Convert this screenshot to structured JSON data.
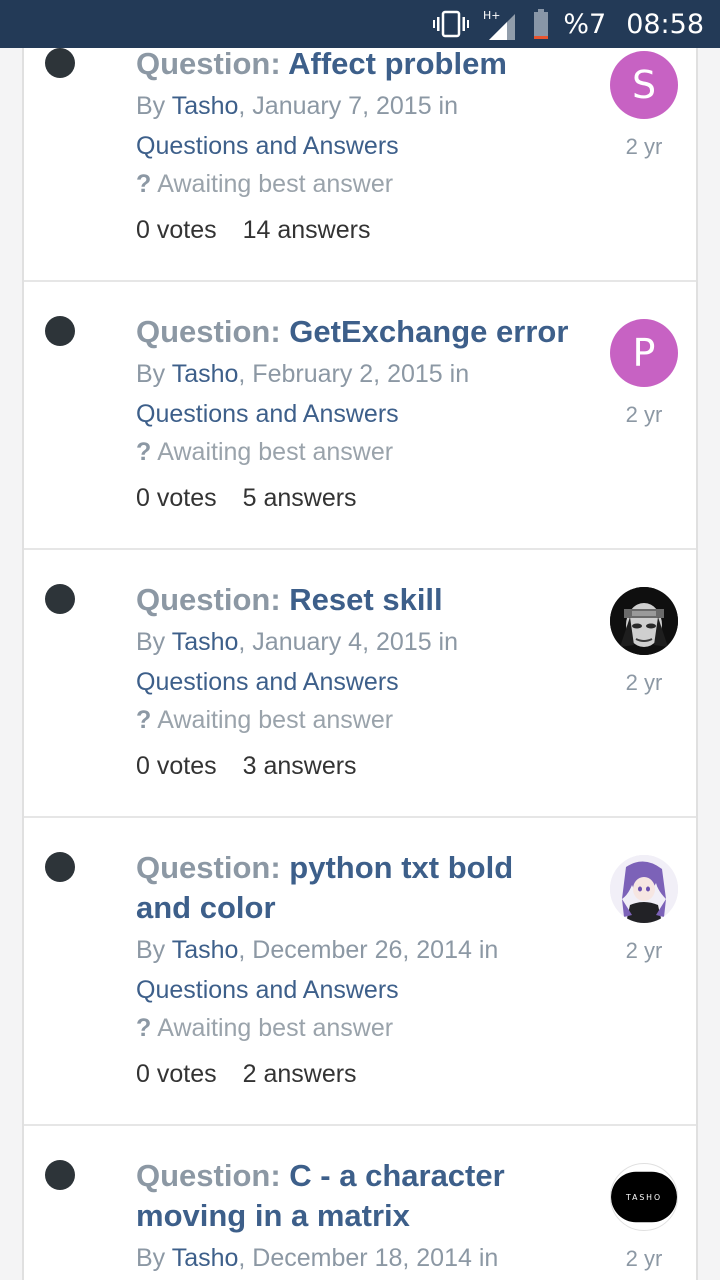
{
  "status_bar": {
    "battery_percent": "%7",
    "time": "08:58",
    "network": "H+"
  },
  "topics": [
    {
      "prefix": "Question:",
      "title": "Affect problem",
      "by": "By",
      "author": "Tasho",
      "date": ", January 7, 2015 in",
      "forum": "Questions and Answers",
      "status_mark": "?",
      "status": "Awaiting best answer",
      "votes": "0 votes",
      "answers": "14 answers",
      "avatar_letter": "S",
      "avatar_color": "#c762c3",
      "ago": "2 yr"
    },
    {
      "prefix": "Question:",
      "title": "GetExchange error",
      "by": "By",
      "author": "Tasho",
      "date": ", February 2, 2015 in",
      "forum": "Questions and Answers",
      "status_mark": "?",
      "status": "Awaiting best answer",
      "votes": "0 votes",
      "answers": "5 answers",
      "avatar_letter": "P",
      "avatar_color": "#c762c3",
      "ago": "2 yr"
    },
    {
      "prefix": "Question:",
      "title": "Reset skill",
      "by": "By",
      "author": "Tasho",
      "date": ", January 4, 2015 in",
      "forum": "Questions and Answers",
      "status_mark": "?",
      "status": "Awaiting best answer",
      "votes": "0 votes",
      "answers": "3 answers",
      "avatar_letter": "",
      "avatar_color": "#1a1a1a",
      "ago": "2 yr"
    },
    {
      "prefix": "Question:",
      "title": "python txt bold and color",
      "by": "By",
      "author": "Tasho",
      "date": ", December 26, 2014 in",
      "forum": "Questions and Answers",
      "status_mark": "?",
      "status": "Awaiting best answer",
      "votes": "0 votes",
      "answers": "2 answers",
      "avatar_letter": "",
      "avatar_color": "#e9e6f2",
      "ago": "2 yr"
    },
    {
      "prefix": "Question:",
      "title": "C - a character moving in a matrix",
      "by": "By",
      "author": "Tasho",
      "date": ", December 18, 2014 in",
      "forum": "",
      "status_mark": "",
      "status": "",
      "votes": "",
      "answers": "",
      "avatar_letter": "",
      "avatar_logo_text": "TASHO",
      "avatar_color": "#000000",
      "ago": "2 yr"
    }
  ]
}
